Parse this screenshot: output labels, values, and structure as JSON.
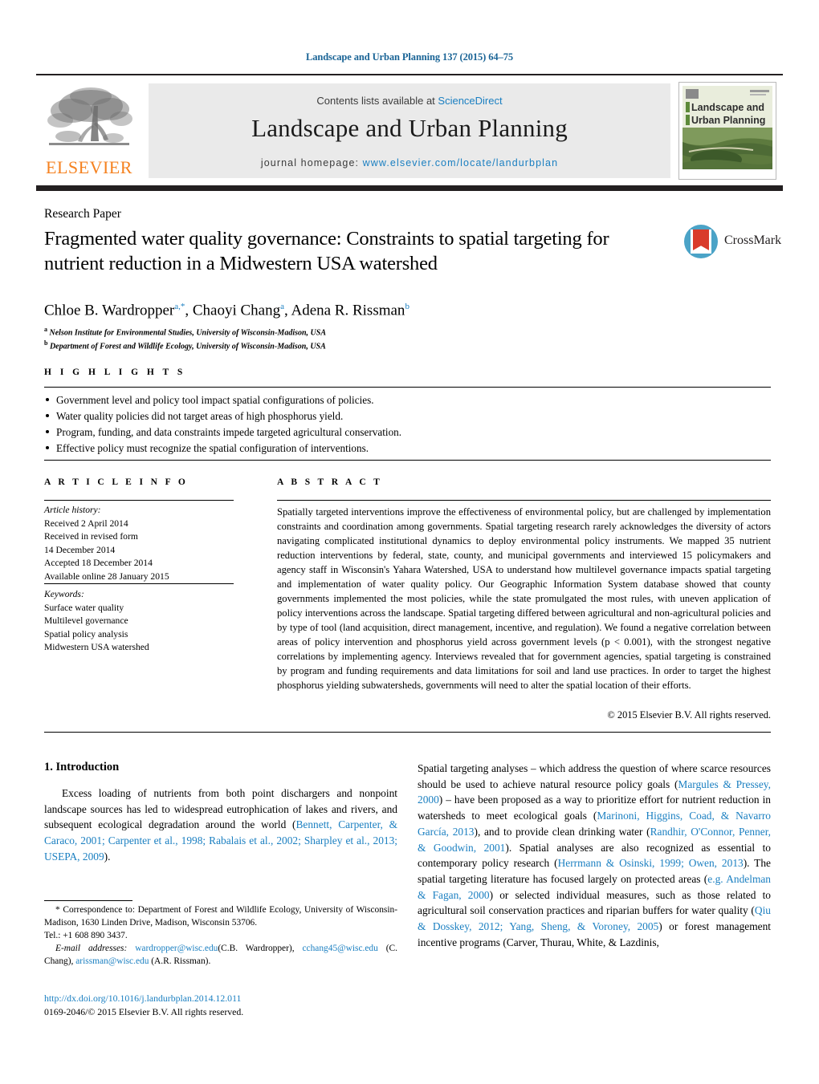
{
  "running_head": "Landscape and Urban Planning 137 (2015) 64–75",
  "masthead": {
    "publisher_name": "ELSEVIER",
    "contents_prefix": "Contents lists available at ",
    "contents_link": "ScienceDirect",
    "journal_title": "Landscape and Urban Planning",
    "homepage_prefix": "journal homepage: ",
    "homepage_url": "www.elsevier.com/locate/landurbplan",
    "cover_title_line1": "Landscape and",
    "cover_title_line2": "Urban Planning"
  },
  "article": {
    "doctype": "Research Paper",
    "title": "Fragmented water quality governance: Constraints to spatial targeting for nutrient reduction in a Midwestern USA watershed",
    "authors_html": "Chloe B. Wardropper<sup>a,*</sup>, Chaoyi Chang<sup>a</sup>, Adena R. Rissman<sup>b</sup>",
    "affiliations": [
      {
        "marker": "a",
        "text": "Nelson Institute for Environmental Studies, University of Wisconsin-Madison, USA"
      },
      {
        "marker": "b",
        "text": "Department of Forest and Wildlife Ecology, University of Wisconsin-Madison, USA"
      }
    ],
    "crossmark_label": "CrossMark"
  },
  "highlights": {
    "heading": "H I G H L I G H T S",
    "items": [
      "Government level and policy tool impact spatial configurations of policies.",
      "Water quality policies did not target areas of high phosphorus yield.",
      "Program, funding, and data constraints impede targeted agricultural conservation.",
      "Effective policy must recognize the spatial configuration of interventions."
    ]
  },
  "article_info": {
    "heading": "A R T I C L E    I N F O",
    "history_label": "Article history:",
    "history_lines": [
      "Received 2 April 2014",
      "Received in revised form",
      "14 December 2014",
      "Accepted 18 December 2014",
      "Available online 28 January 2015"
    ],
    "keywords_label": "Keywords:",
    "keywords": [
      "Surface water quality",
      "Multilevel governance",
      "Spatial policy analysis",
      "Midwestern USA watershed"
    ]
  },
  "abstract": {
    "heading": "A B S T R A C T",
    "text": "Spatially targeted interventions improve the effectiveness of environmental policy, but are challenged by implementation constraints and coordination among governments. Spatial targeting research rarely acknowledges the diversity of actors navigating complicated institutional dynamics to deploy environmental policy instruments. We mapped 35 nutrient reduction interventions by federal, state, county, and municipal governments and interviewed 15 policymakers and agency staff in Wisconsin's Yahara Watershed, USA to understand how multilevel governance impacts spatial targeting and implementation of water quality policy. Our Geographic Information System database showed that county governments implemented the most policies, while the state promulgated the most rules, with uneven application of policy interventions across the landscape. Spatial targeting differed between agricultural and non-agricultural policies and by type of tool (land acquisition, direct management, incentive, and regulation). We found a negative correlation between areas of policy intervention and phosphorus yield across government levels (p < 0.001), with the strongest negative correlations by implementing agency. Interviews revealed that for government agencies, spatial targeting is constrained by program and funding requirements and data limitations for soil and land use practices. In order to target the highest phosphorus yielding subwatersheds, governments will need to alter the spatial location of their efforts.",
    "copyright": "© 2015 Elsevier B.V. All rights reserved."
  },
  "body": {
    "section_number_title": "1.  Introduction",
    "left_paragraph_plain": "Excess loading of nutrients from both point dischargers and nonpoint landscape sources has led to widespread eutrophication of lakes and rivers, and subsequent ecological degradation around the world (Bennett, Carpenter, & Caraco, 2001; Carpenter et al., 1998; Rabalais et al., 2002; Sharpley et al., 2013; USEPA, 2009).",
    "right_paragraph_plain": "Spatial targeting analyses – which address the question of where scarce resources should be used to achieve natural resource policy goals (Margules & Pressey, 2000) – have been proposed as a way to prioritize effort for nutrient reduction in watersheds to meet ecological goals (Marinoni, Higgins, Coad, & Navarro García, 2013), and to provide clean drinking water (Randhir, O'Connor, Penner, & Goodwin, 2001). Spatial analyses are also recognized as essential to contemporary policy research (Herrmann & Osinski, 1999; Owen, 2013). The spatial targeting literature has focused largely on protected areas (e.g. Andelman & Fagan, 2000) or selected individual measures, such as those related to agricultural soil conservation practices and riparian buffers for water quality (Qiu & Dosskey, 2012; Yang, Sheng, & Voroney, 2005) or forest management incentive programs (Carver, Thurau, White, & Lazdinis,"
  },
  "footnote": {
    "marker": "*",
    "correspondence": "Correspondence to: Department of Forest and Wildlife Ecology, University of Wisconsin-Madison, 1630 Linden Drive, Madison, Wisconsin 53706.",
    "tel": "Tel.: +1 608 890 3437.",
    "email_label": "E-mail addresses:",
    "emails": [
      {
        "address": "wardropper@wisc.edu",
        "person": "(C.B. Wardropper)"
      },
      {
        "address": "cchang45@wisc.edu",
        "person": "(C. Chang)"
      },
      {
        "address": "arissman@wisc.edu",
        "person": "(A.R. Rissman)"
      }
    ],
    "doi": "http://dx.doi.org/10.1016/j.landurbplan.2014.12.011",
    "issn_line": "0169-2046/© 2015 Elsevier B.V. All rights reserved."
  },
  "colors": {
    "link_blue": "#1a7fc1",
    "headrule_black": "#231f20",
    "elsevier_orange": "#f58220",
    "panel_grey": "#eaeaea",
    "crossmark_blue": "#4ba3c7",
    "crossmark_red": "#d93b2b"
  }
}
